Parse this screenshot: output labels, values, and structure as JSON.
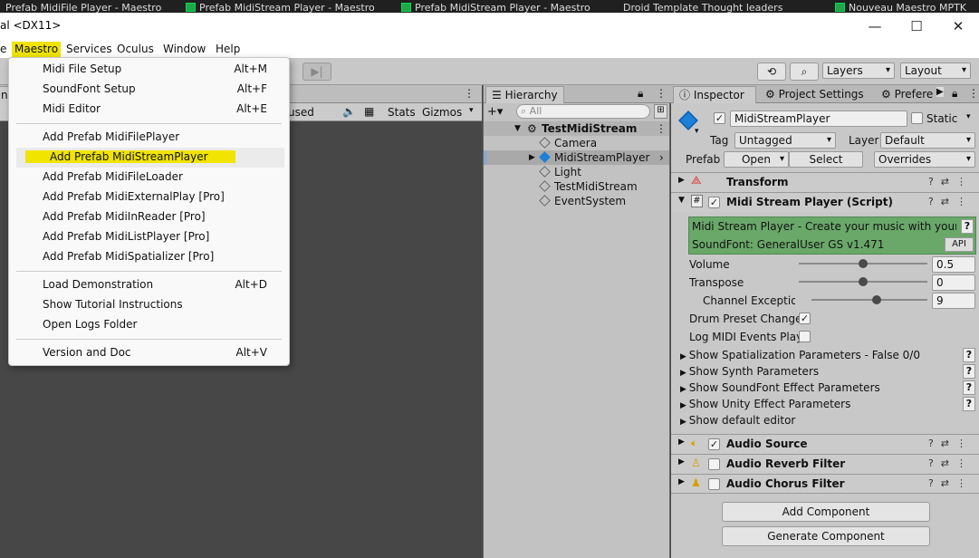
{
  "taskbar": {
    "items": [
      "Prefab MidiFile Player - Maestro",
      "Prefab MidiStream Player - Maestro",
      "Prefab MidiStream Player - Maestro",
      "Droid Template Thought leaders",
      "Nouveau Maestro MPTK"
    ]
  },
  "window": {
    "title": "al <DX11>",
    "min_icon": "—",
    "max_icon": "☐",
    "close_icon": "✕"
  },
  "menubar": {
    "items": [
      "e",
      "Maestro",
      "Services",
      "Oculus",
      "Window",
      "Help"
    ]
  },
  "toolbar": {
    "history_icon": "⟲",
    "search_icon": "⌕",
    "layers_label": "Layers",
    "layout_label": "Layout",
    "step_icon": "▶|"
  },
  "scene": {
    "tab_partial": "nd",
    "bar_partial": "used",
    "mute_icon": "🔈",
    "grid_icon": "▦",
    "stats_label": "Stats",
    "gizmos_label": "Gizmos"
  },
  "hierarchy": {
    "tab_label": "Hierarchy",
    "add_label": "+▾",
    "search_placeholder": "All",
    "root": "TestMidiStream",
    "items": [
      "Camera",
      "MidiStreamPlayer",
      "Light",
      "TestMidiStream",
      "EventSystem"
    ]
  },
  "inspector": {
    "tabs": [
      "Inspector",
      "Project Settings",
      "Prefere"
    ],
    "object_name": "MidiStreamPlayer",
    "static_label": "Static",
    "tag_label": "Tag",
    "tag_value": "Untagged",
    "layer_label": "Layer",
    "layer_value": "Default",
    "prefab_label": "Prefab",
    "open_label": "Open",
    "select_label": "Select",
    "overrides_label": "Overrides",
    "transform_label": "Transform",
    "script_label": "Midi Stream Player (Script)",
    "banner_line1": "Midi Stream Player - Create your music with your algo",
    "banner_line2": "SoundFont: GeneralUser GS v1.471",
    "api_label": "API",
    "volume_label": "Volume",
    "volume_value": "0.5",
    "volume_fraction": 0.5,
    "transpose_label": "Transpose",
    "transpose_value": "0",
    "transpose_fraction": 0.5,
    "channel_label": "Channel Exception",
    "channel_value": "9",
    "channel_fraction": 0.56,
    "drum_label": "Drum Preset Change",
    "log_label": "Log MIDI Events Play",
    "foldouts": [
      "Show Spatialization Parameters - False 0/0",
      "Show Synth Parameters",
      "Show SoundFont Effect Parameters",
      "Show Unity Effect Parameters",
      "Show default editor"
    ],
    "audio_source_label": "Audio Source",
    "reverb_label": "Audio Reverb Filter",
    "chorus_label": "Audio Chorus Filter",
    "add_component_label": "Add Component",
    "generate_component_label": "Generate Component"
  },
  "menu": {
    "items": [
      {
        "label": "Midi File Setup",
        "shortcut": "Alt+M"
      },
      {
        "label": "SoundFont Setup",
        "shortcut": "Alt+F"
      },
      {
        "label": "Midi Editor",
        "shortcut": "Alt+E"
      },
      {
        "label": "Add Prefab MidiFilePlayer",
        "shortcut": ""
      },
      {
        "label": "Add Prefab MidiStreamPlayer",
        "shortcut": ""
      },
      {
        "label": "Add Prefab MidiFileLoader",
        "shortcut": ""
      },
      {
        "label": "Add Prefab MidiExternalPlay [Pro]",
        "shortcut": ""
      },
      {
        "label": "Add Prefab MidiInReader [Pro]",
        "shortcut": ""
      },
      {
        "label": "Add Prefab MidiListPlayer [Pro]",
        "shortcut": ""
      },
      {
        "label": "Add Prefab MidiSpatializer [Pro]",
        "shortcut": ""
      },
      {
        "label": "Load Demonstration",
        "shortcut": "Alt+D"
      },
      {
        "label": "Show Tutorial Instructions",
        "shortcut": ""
      },
      {
        "label": "Open Logs Folder",
        "shortcut": ""
      },
      {
        "label": "Version and Doc",
        "shortcut": "Alt+V"
      }
    ]
  },
  "colors": {
    "highlight": "#f0e400",
    "banner_bg": "#6aa86a",
    "unity_blue": "#1e7fd8"
  }
}
